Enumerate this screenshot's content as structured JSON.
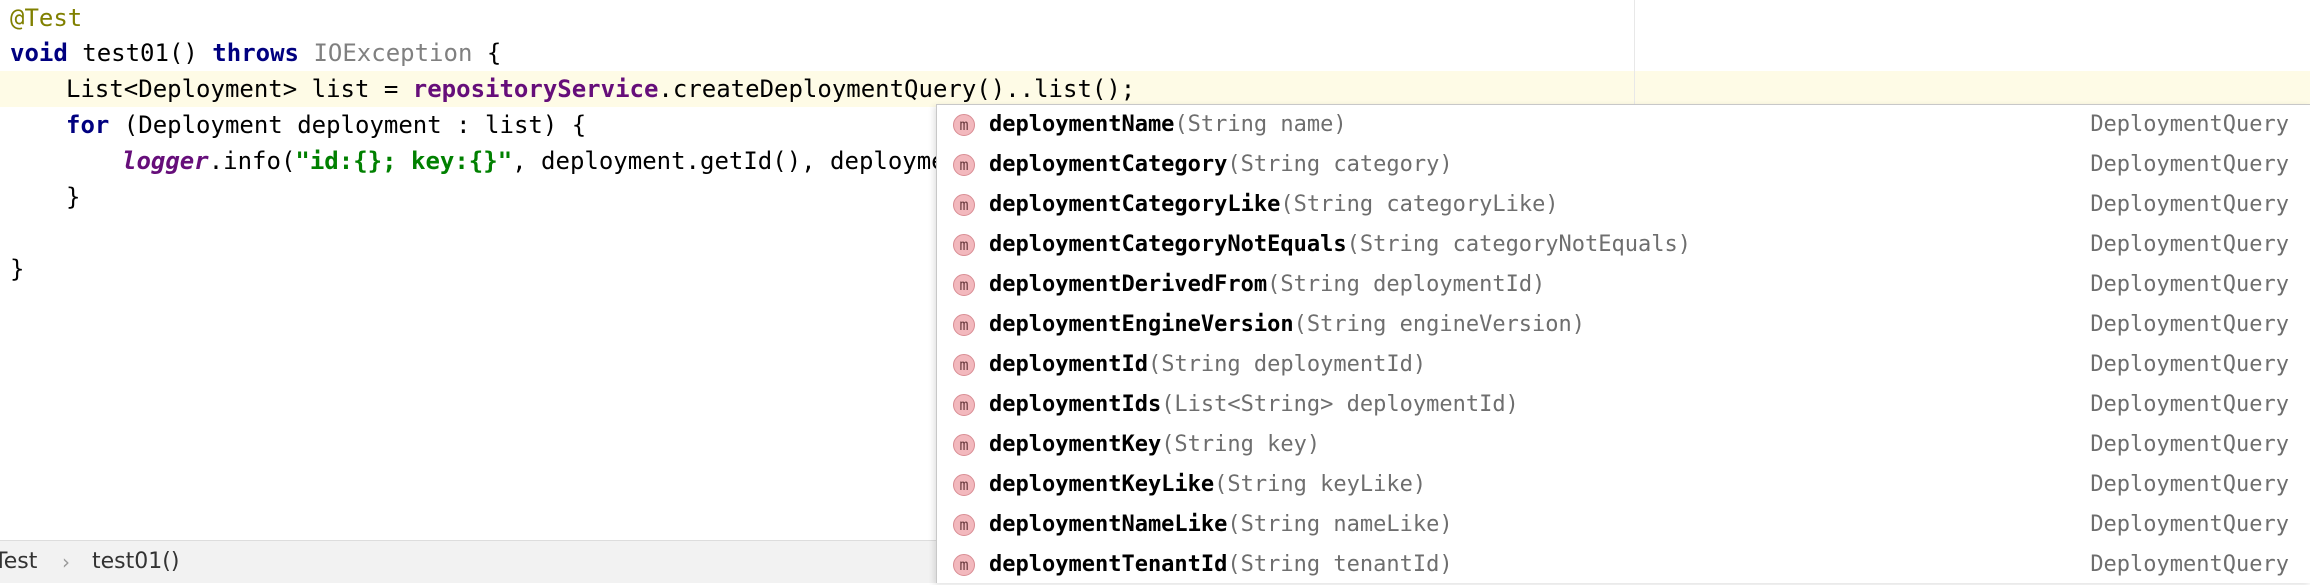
{
  "editor": {
    "line1": {
      "annotation": "@Test"
    },
    "line2": {
      "kw_void": "void",
      "text_a": " test01() ",
      "kw_throws": "throws",
      "space": " ",
      "exception": "IOException",
      "text_b": " {"
    },
    "line3": {
      "text_a": "List<Deployment> list = ",
      "field": "repositoryService",
      "text_b": ".createDeploymentQuery()..list();"
    },
    "line4": {
      "kw_for": "for",
      "text_a": " (Deployment deployment : list) {"
    },
    "line5": {
      "static_field": "logger",
      "text_a": ".info(",
      "string": "\"id:{}; key:{}\"",
      "text_b": ", deployment.getId(), deployment"
    },
    "line6": {
      "text": "}"
    },
    "line8": {
      "text": "}"
    }
  },
  "statusbar": {
    "crumb_class": "Test",
    "separator": "›",
    "crumb_method": "test01()"
  },
  "completion": {
    "icon_letter": "m",
    "items": [
      {
        "name": "deploymentName",
        "params": "(String name)",
        "type": "DeploymentQuery"
      },
      {
        "name": "deploymentCategory",
        "params": "(String category)",
        "type": "DeploymentQuery"
      },
      {
        "name": "deploymentCategoryLike",
        "params": "(String categoryLike)",
        "type": "DeploymentQuery"
      },
      {
        "name": "deploymentCategoryNotEquals",
        "params": "(String categoryNotEquals)",
        "type": "DeploymentQuery"
      },
      {
        "name": "deploymentDerivedFrom",
        "params": "(String deploymentId)",
        "type": "DeploymentQuery"
      },
      {
        "name": "deploymentEngineVersion",
        "params": "(String engineVersion)",
        "type": "DeploymentQuery"
      },
      {
        "name": "deploymentId",
        "params": "(String deploymentId)",
        "type": "DeploymentQuery"
      },
      {
        "name": "deploymentIds",
        "params": "(List<String> deploymentId)",
        "type": "DeploymentQuery"
      },
      {
        "name": "deploymentKey",
        "params": "(String key)",
        "type": "DeploymentQuery"
      },
      {
        "name": "deploymentKeyLike",
        "params": "(String keyLike)",
        "type": "DeploymentQuery"
      },
      {
        "name": "deploymentNameLike",
        "params": "(String nameLike)",
        "type": "DeploymentQuery"
      },
      {
        "name": "deploymentTenantId",
        "params": "(String tenantId)",
        "type": "DeploymentQuery"
      }
    ]
  }
}
